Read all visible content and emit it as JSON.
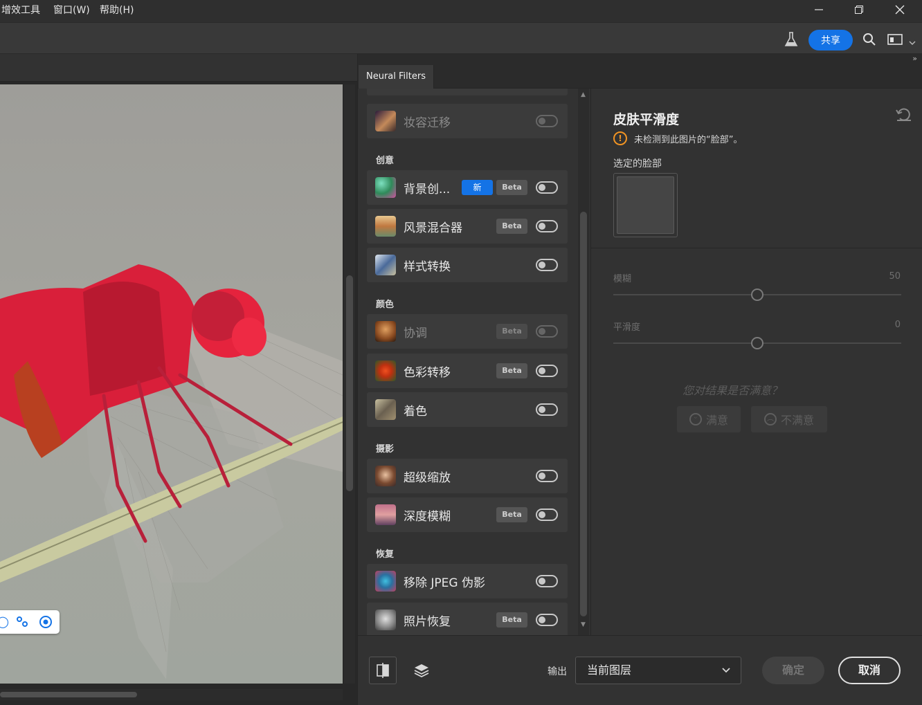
{
  "menubar": {
    "items": [
      "增效工具",
      "窗口(W)",
      "帮助(H)"
    ],
    "window_controls": [
      "minimize-icon",
      "restore-icon",
      "close-icon"
    ]
  },
  "toolbar": {
    "share_label": "共享",
    "icons": [
      "flask-icon",
      "search-icon",
      "workspace-icon",
      "chevron-down-icon"
    ]
  },
  "neural_filters": {
    "tab_label": "Neural Filters",
    "categories": {
      "creative": "创意",
      "color": "颜色",
      "photography": "摄影",
      "restoration": "恢复"
    },
    "filters": {
      "makeup_transfer": {
        "label": "妆容迁移",
        "enabled": false
      },
      "background_creator": {
        "label": "背景创...",
        "new_tag": "新",
        "beta_tag": "Beta",
        "enabled": false
      },
      "landscape_mixer": {
        "label": "风景混合器",
        "beta_tag": "Beta",
        "enabled": false
      },
      "style_transfer": {
        "label": "样式转换",
        "enabled": false
      },
      "harmonization": {
        "label": "协调",
        "beta_tag": "Beta",
        "enabled": false
      },
      "color_transfer": {
        "label": "色彩转移",
        "beta_tag": "Beta",
        "enabled": false
      },
      "colorize": {
        "label": "着色",
        "enabled": false
      },
      "super_zoom": {
        "label": "超级缩放",
        "enabled": false
      },
      "depth_blur": {
        "label": "深度模糊",
        "beta_tag": "Beta",
        "enabled": false
      },
      "jpeg_artifacts": {
        "label": "移除 JPEG 伪影",
        "enabled": false
      },
      "photo_restoration": {
        "label": "照片恢复",
        "beta_tag": "Beta",
        "enabled": false
      }
    }
  },
  "settings": {
    "title": "皮肤平滑度",
    "warning": "未检测到此图片的“脸部”。",
    "selected_face_label": "选定的脸部",
    "blur": {
      "label": "模糊",
      "value": "50",
      "fraction": 0.5
    },
    "smoothness": {
      "label": "平滑度",
      "value": "0",
      "fraction": 0.5
    },
    "satisfaction_question": "您对结果是否满意？",
    "satisfied_label": "满意",
    "unsatisfied_label": "不满意"
  },
  "bottom": {
    "output_label": "输出",
    "output_value": "当前图层",
    "ok_label": "确定",
    "cancel_label": "取消"
  },
  "colors": {
    "accent": "#1473e6",
    "warning": "#f29423",
    "panel_bg": "#323232"
  }
}
